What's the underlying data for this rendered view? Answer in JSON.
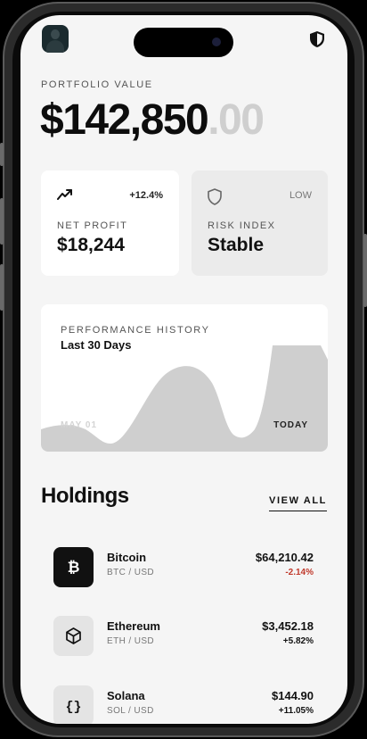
{
  "portfolio": {
    "label": "PORTFOLIO VALUE",
    "value_main": "$142,850",
    "value_cents": ".00"
  },
  "stats": {
    "net_profit": {
      "badge": "+12.4%",
      "label": "NET PROFIT",
      "value": "$18,244",
      "icon": "trending-up-icon"
    },
    "risk": {
      "badge": "LOW",
      "label": "RISK INDEX",
      "value": "Stable",
      "icon": "shield-icon"
    }
  },
  "performance": {
    "label": "PERFORMANCE HISTORY",
    "title": "Last 30 Days",
    "start_label": "MAY 01",
    "end_label": "TODAY"
  },
  "holdings": {
    "title": "Holdings",
    "view_all": "VIEW ALL",
    "items": [
      {
        "name": "Bitcoin",
        "pair": "BTC / USD",
        "price": "$64,210.42",
        "change": "-2.14%",
        "icon": "bitcoin-icon"
      },
      {
        "name": "Ethereum",
        "pair": "ETH / USD",
        "price": "$3,452.18",
        "change": "+5.82%",
        "icon": "cube-icon"
      },
      {
        "name": "Solana",
        "pair": "SOL / USD",
        "price": "$144.90",
        "change": "+11.05%",
        "icon": "braces-icon"
      }
    ]
  },
  "colors": {
    "background": "#f5f5f5",
    "negative": "#c0392b",
    "chart_fill": "#cfcfcf"
  }
}
